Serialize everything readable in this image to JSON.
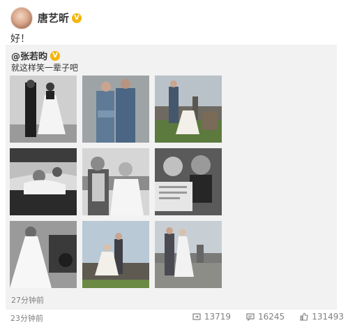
{
  "post": {
    "author": "唐艺昕",
    "verified_badge": "V",
    "text": "好！",
    "time": "23分钟前"
  },
  "repost": {
    "author": "@张若昀",
    "verified_badge": "V",
    "text": "就这样笑一辈子吧",
    "time": "27分钟前",
    "photos": [
      {
        "name": "photo-couple-studio-bw"
      },
      {
        "name": "photo-couple-denim"
      },
      {
        "name": "photo-couple-field-castle"
      },
      {
        "name": "photo-couple-car-bw"
      },
      {
        "name": "photo-couple-coast-closeup"
      },
      {
        "name": "photo-couple-newspaper-bw"
      },
      {
        "name": "photo-bride-car-bw"
      },
      {
        "name": "photo-couple-rocks-sky"
      },
      {
        "name": "photo-couple-castle-walk"
      }
    ]
  },
  "actions": {
    "forward_count": "13719",
    "comment_count": "16245",
    "like_count": "131493"
  },
  "colors": {
    "badge": "#f5b50a",
    "meta_gray": "#808080",
    "repost_bg": "#f2f2f2"
  }
}
